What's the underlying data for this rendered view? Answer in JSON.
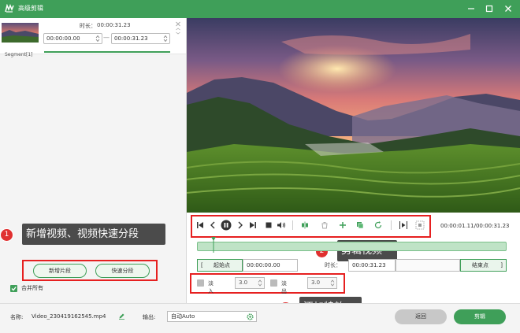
{
  "window": {
    "title": "高级剪辑"
  },
  "segment": {
    "duration_label": "时长：",
    "duration": "00:00:31.23",
    "start": "00:00:00.00",
    "end": "00:00:31.23",
    "dash": "—",
    "label": "Segment[1]"
  },
  "left_actions": {
    "new_segment": "新增片段",
    "quick_split": "快速分段"
  },
  "merge": {
    "label": "合并所有",
    "checked": true
  },
  "callouts": {
    "c1": {
      "num": "1",
      "text": "新增视频、视频快速分段"
    },
    "c2": {
      "num": "2",
      "text": "剪辑视频"
    },
    "c3": {
      "num": "3",
      "text": "添加特效"
    }
  },
  "player": {
    "current_time": "00:00:01.11",
    "total_time": "00:00:31.23",
    "separator": "/",
    "progress": 0.036
  },
  "range": {
    "start_btn": "起始点",
    "start_bracket": "[",
    "start_time": "00:00:00.00",
    "duration_label": "时长：",
    "duration": "00:00:31.23",
    "end_btn": "结束点",
    "end_bracket": "]"
  },
  "effects": {
    "fade_in_label": "淡入",
    "fade_in_value": "3.0",
    "fade_out_label": "淡出",
    "fade_out_value": "3.0"
  },
  "bottom": {
    "name_label": "名称:",
    "filename": "Video_230419162545.mp4",
    "output_label": "输出:",
    "output_value": "自动Auto",
    "back_btn": "返回",
    "edit_btn": "剪辑"
  },
  "colors": {
    "accent": "#3f9f59",
    "callout_red": "#e03030",
    "highlight_box": "#e62020"
  }
}
